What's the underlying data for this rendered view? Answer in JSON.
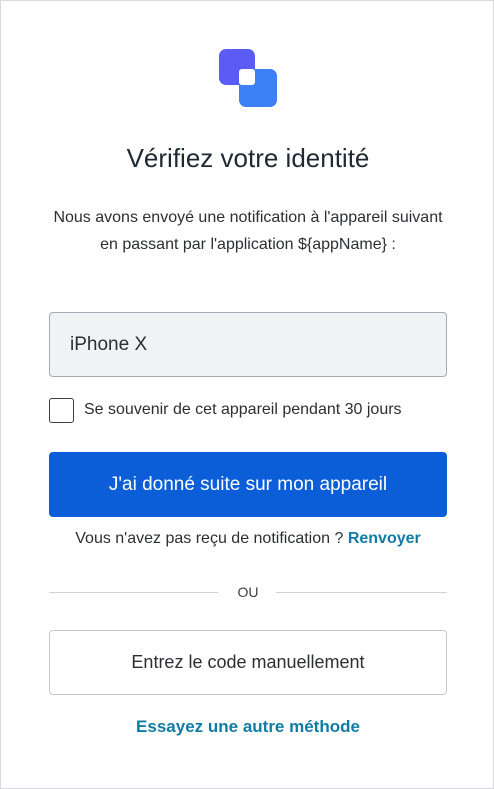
{
  "logo": {
    "icon": "app-logo-icon",
    "colors": [
      "#5b5cf6",
      "#3d7ff5"
    ]
  },
  "header": {
    "title": "Vérifiez votre identité"
  },
  "description": "Nous avons envoyé une notification à l'appareil suivant en passant par l'application ${appName} :",
  "device": {
    "name": "iPhone X"
  },
  "remember": {
    "label": "Se souvenir de cet appareil pendant 30 jours",
    "checked": false
  },
  "actions": {
    "confirm_label": "J'ai donné suite sur mon appareil",
    "no_notification_text": "Vous n'avez pas reçu de notification ?",
    "resend_label": "Renvoyer",
    "or_label": "OU",
    "manual_code_label": "Entrez le code manuellement",
    "other_method_label": "Essayez une autre méthode"
  },
  "colors": {
    "primary": "#0b5ed7",
    "link": "#0f7ca6"
  }
}
